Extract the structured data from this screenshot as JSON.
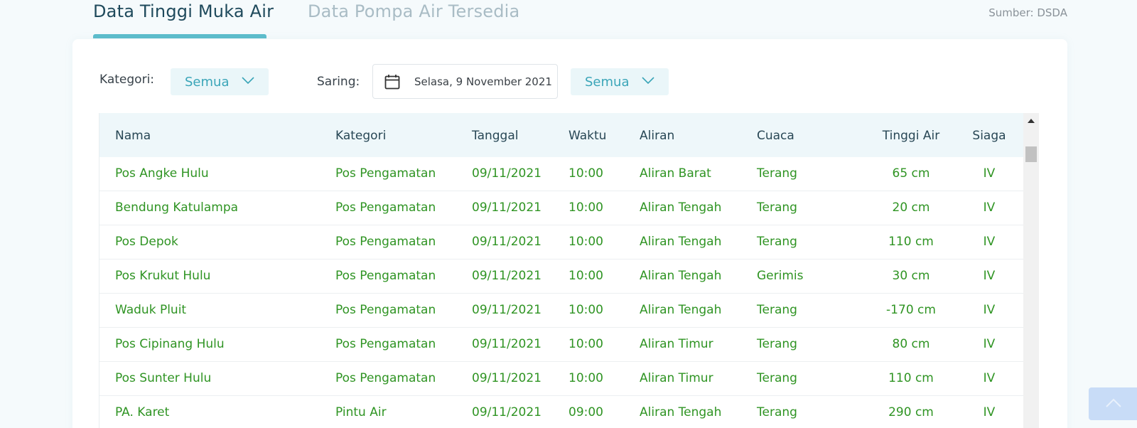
{
  "tabs": [
    {
      "label": "Data Tinggi Muka Air",
      "active": true
    },
    {
      "label": "Data Pompa Air Tersedia",
      "active": false
    }
  ],
  "source": "Sumber: DSDA",
  "filters": {
    "kategori_label": "Kategori:",
    "kategori_value": "Semua",
    "saring_label": "Saring:",
    "date_value": "Selasa, 9 November 2021",
    "saring_value": "Semua"
  },
  "table": {
    "headers": [
      "Nama",
      "Kategori",
      "Tanggal",
      "Waktu",
      "Aliran",
      "Cuaca",
      "Tinggi Air",
      "Siaga"
    ],
    "rows": [
      [
        "Pos Angke Hulu",
        "Pos Pengamatan",
        "09/11/2021",
        "10:00",
        "Aliran Barat",
        "Terang",
        "65 cm",
        "IV"
      ],
      [
        "Bendung Katulampa",
        "Pos Pengamatan",
        "09/11/2021",
        "10:00",
        "Aliran Tengah",
        "Terang",
        "20 cm",
        "IV"
      ],
      [
        "Pos Depok",
        "Pos Pengamatan",
        "09/11/2021",
        "10:00",
        "Aliran Tengah",
        "Terang",
        "110 cm",
        "IV"
      ],
      [
        "Pos Krukut Hulu",
        "Pos Pengamatan",
        "09/11/2021",
        "10:00",
        "Aliran Tengah",
        "Gerimis",
        "30 cm",
        "IV"
      ],
      [
        "Waduk Pluit",
        "Pos Pengamatan",
        "09/11/2021",
        "10:00",
        "Aliran Tengah",
        "Terang",
        "-170 cm",
        "IV"
      ],
      [
        "Pos Cipinang Hulu",
        "Pos Pengamatan",
        "09/11/2021",
        "10:00",
        "Aliran Timur",
        "Terang",
        "80 cm",
        "IV"
      ],
      [
        "Pos Sunter Hulu",
        "Pos Pengamatan",
        "09/11/2021",
        "10:00",
        "Aliran Timur",
        "Terang",
        "110 cm",
        "IV"
      ],
      [
        "PA. Karet",
        "Pintu Air",
        "09/11/2021",
        "09:00",
        "Aliran Tengah",
        "Terang",
        "290 cm",
        "IV"
      ]
    ]
  },
  "colors": {
    "accent": "#5dbdcc",
    "row_text": "#2f9423",
    "header_bg": "#eef7fa",
    "select_text": "#3aa5b8"
  },
  "icons": {
    "calendar": "calendar-icon",
    "chevron": "chevron-down-icon",
    "back_to_top": "chevron-up-icon"
  }
}
